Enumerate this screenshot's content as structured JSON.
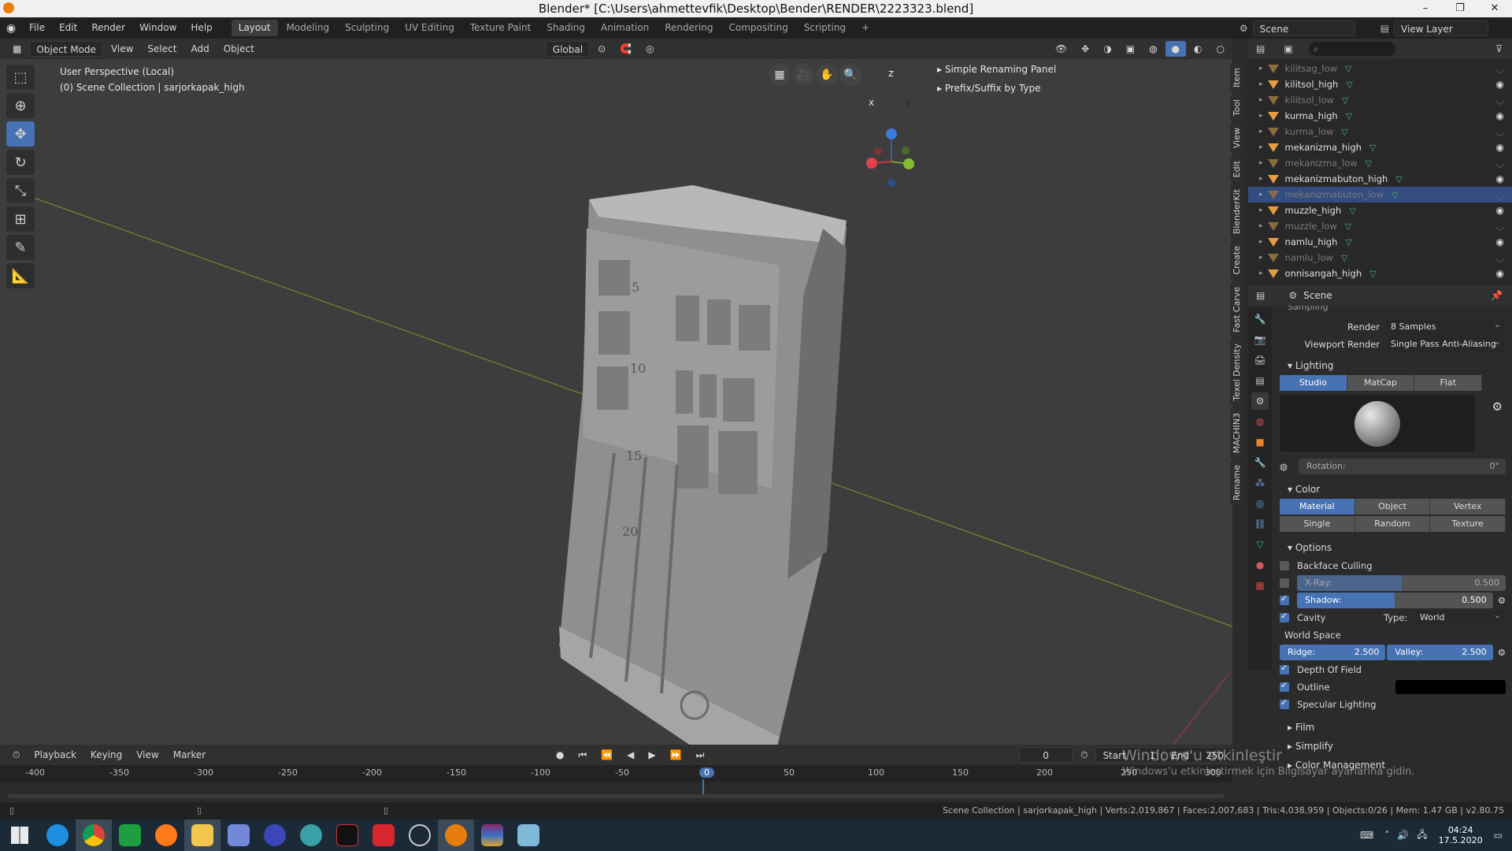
{
  "window": {
    "title": "Blender* [C:\\Users\\ahmettevfik\\Desktop\\Bender\\RENDER\\2223323.blend]",
    "min": "–",
    "max": "❐",
    "close": "✕"
  },
  "menu": [
    "File",
    "Edit",
    "Render",
    "Window",
    "Help"
  ],
  "workspaces": [
    "Layout",
    "Modeling",
    "Sculpting",
    "UV Editing",
    "Texture Paint",
    "Shading",
    "Animation",
    "Rendering",
    "Compositing",
    "Scripting"
  ],
  "workspace_add": "+",
  "scene": {
    "label": "Scene",
    "view_layer": "View Layer"
  },
  "viewport_header": {
    "mode": "Object Mode",
    "view": "View",
    "select": "Select",
    "add": "Add",
    "object": "Object",
    "orientation": "Global"
  },
  "viewport": {
    "perspective": "User Perspective (Local)",
    "collection": "(0) Scene Collection | sarjorkapak_high",
    "panels": [
      "Simple Renaming Panel",
      "Prefix/Suffix by Type"
    ],
    "axes": {
      "x": "X",
      "y": "Y",
      "z": "Z"
    }
  },
  "model_numbers": [
    "5",
    "10",
    "15",
    "20"
  ],
  "side_tabs": [
    "Item",
    "Tool",
    "View",
    "Edit",
    "BlenderKit",
    "Create",
    "Fast Carve",
    "Texel Density",
    "MACHIN3",
    "Rename"
  ],
  "outliner": {
    "rows": [
      {
        "name": "kilitsag_low",
        "dim": true
      },
      {
        "name": "kilitsol_high",
        "dim": false
      },
      {
        "name": "kilitsol_low",
        "dim": true
      },
      {
        "name": "kurma_high",
        "dim": false
      },
      {
        "name": "kurma_low",
        "dim": true
      },
      {
        "name": "mekanizma_high",
        "dim": false
      },
      {
        "name": "mekanizma_low",
        "dim": true
      },
      {
        "name": "mekanizmabuton_high",
        "dim": false
      },
      {
        "name": "mekanizmabuton_low",
        "dim": true,
        "selected": true
      },
      {
        "name": "muzzle_high",
        "dim": false
      },
      {
        "name": "muzzle_low",
        "dim": true
      },
      {
        "name": "namlu_high",
        "dim": false
      },
      {
        "name": "namlu_low",
        "dim": true
      },
      {
        "name": "onnisangah_high",
        "dim": false
      }
    ]
  },
  "props": {
    "context": "Scene",
    "sampling": "Sampling",
    "render_label": "Render",
    "render_value": "8 Samples",
    "vp_render_label": "Viewport Render",
    "vp_render_value": "Single Pass Anti-Aliasing",
    "lighting": "Lighting",
    "lighting_modes": [
      "Studio",
      "MatCap",
      "Flat"
    ],
    "rotation_label": "Rotation:",
    "rotation_value": "0°",
    "color": "Color",
    "color_modes": [
      "Material",
      "Object",
      "Vertex",
      "Single",
      "Random",
      "Texture"
    ],
    "options": "Options",
    "backface": "Backface Culling",
    "xray_label": "X-Ray:",
    "xray_value": "0.500",
    "xray_fraction": 0.5,
    "shadow_label": "Shadow:",
    "shadow_value": "0.500",
    "shadow_fraction": 0.5,
    "cavity": "Cavity",
    "type_label": "Type:",
    "type_value": "World",
    "world_space": "World Space",
    "ridge_label": "Ridge:",
    "ridge_value": "2.500",
    "valley_label": "Valley:",
    "valley_value": "2.500",
    "dof": "Depth Of Field",
    "outline": "Outline",
    "specular": "Specular Lighting",
    "film": "Film",
    "simplify": "Simplify",
    "color_mgmt": "Color Management"
  },
  "timeline": {
    "playback": "Playback",
    "keying": "Keying",
    "view": "View",
    "marker": "Marker",
    "frame": "0",
    "start_label": "Start",
    "start_value": "1",
    "end_label": "End",
    "end_value": "250",
    "ticks": [
      "-400",
      "-350",
      "-300",
      "-250",
      "-200",
      "-150",
      "-100",
      "-50",
      "0",
      "50",
      "100",
      "150",
      "200",
      "250",
      "300"
    ]
  },
  "watermark": {
    "line1": "Windows'u etkinleştir",
    "line2": "Windows'u etkinleştirmek için Bilgisayar ayarlarına gidin."
  },
  "status": "Scene Collection | sarjorkapak_high | Verts:2,019,867 | Faces:2,007,683 | Tris:4,038,959 | Objects:0/26 | Mem: 1.47 GB | v2.80.75",
  "clock": {
    "time": "04:24",
    "date": "17.5.2020"
  }
}
